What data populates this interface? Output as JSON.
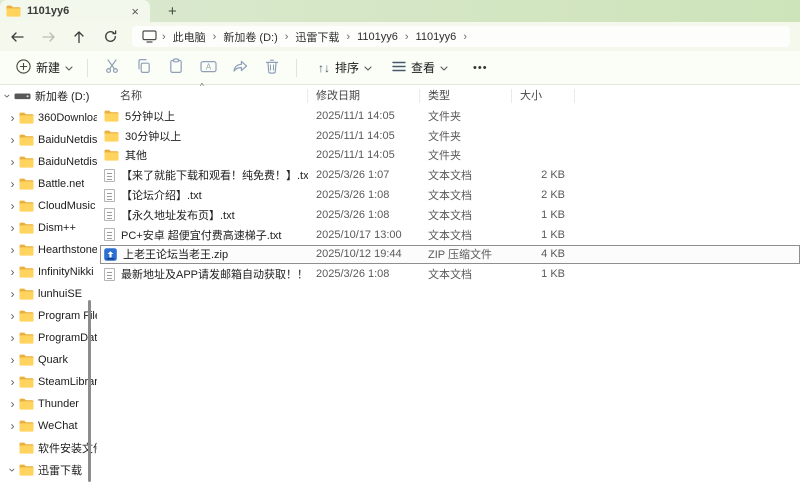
{
  "tab_bar": {
    "active_tab": {
      "label": "1101yy6",
      "icon": "folder-icon",
      "close_glyph": "×"
    },
    "new_tab_glyph": "+"
  },
  "nav": {
    "back_icon": "arrow-left",
    "forward_icon": "arrow-right",
    "up_icon": "arrow-up",
    "refresh_icon": "refresh",
    "forward_disabled": true
  },
  "breadcrumb": {
    "device_icon": "monitor-icon",
    "separator": "›",
    "items": [
      "此电脑",
      "新加卷 (D:)",
      "迅雷下载",
      "1101yy6",
      "1101yy6"
    ]
  },
  "toolbar": {
    "new_label": "新建",
    "actions": [
      "cut",
      "copy",
      "paste",
      "rename",
      "share",
      "delete"
    ],
    "sort_glyph": "↑↓",
    "sort_label": "排序",
    "view_label": "查看",
    "more_glyph": "•••"
  },
  "sidebar": {
    "items": [
      {
        "label": "新加卷 (D:)",
        "icon": "drive",
        "chevron": "expanded",
        "depth": 0
      },
      {
        "label": "360Downloa",
        "icon": "folder",
        "chevron": "collapsed",
        "depth": 1
      },
      {
        "label": "BaiduNetdis",
        "icon": "folder",
        "chevron": "collapsed",
        "depth": 1
      },
      {
        "label": "BaiduNetdis",
        "icon": "folder",
        "chevron": "collapsed",
        "depth": 1
      },
      {
        "label": "Battle.net",
        "icon": "folder",
        "chevron": "collapsed",
        "depth": 1
      },
      {
        "label": "CloudMusic",
        "icon": "folder",
        "chevron": "collapsed",
        "depth": 1
      },
      {
        "label": "Dism++",
        "icon": "folder",
        "chevron": "collapsed",
        "depth": 1
      },
      {
        "label": "Hearthstone",
        "icon": "folder",
        "chevron": "collapsed",
        "depth": 1
      },
      {
        "label": "InfinityNikki",
        "icon": "folder",
        "chevron": "collapsed",
        "depth": 1
      },
      {
        "label": "lunhuiSE",
        "icon": "folder",
        "chevron": "collapsed",
        "depth": 1
      },
      {
        "label": "Program File",
        "icon": "folder",
        "chevron": "collapsed",
        "depth": 1
      },
      {
        "label": "ProgramDat",
        "icon": "folder",
        "chevron": "collapsed",
        "depth": 1
      },
      {
        "label": "Quark",
        "icon": "folder",
        "chevron": "collapsed",
        "depth": 1
      },
      {
        "label": "SteamLibrar",
        "icon": "folder",
        "chevron": "collapsed",
        "depth": 1
      },
      {
        "label": "Thunder",
        "icon": "folder",
        "chevron": "collapsed",
        "depth": 1
      },
      {
        "label": "WeChat",
        "icon": "folder",
        "chevron": "collapsed",
        "depth": 1
      },
      {
        "label": "软件安装文件",
        "icon": "folder",
        "chevron": "none",
        "depth": 1
      },
      {
        "label": "迅雷下载",
        "icon": "folder",
        "chevron": "expanded",
        "depth": 1
      }
    ]
  },
  "file_list": {
    "columns": [
      {
        "label": "名称",
        "sort": "asc"
      },
      {
        "label": "修改日期"
      },
      {
        "label": "类型"
      },
      {
        "label": "大小"
      }
    ],
    "sort_caret_glyph": "^",
    "rows": [
      {
        "name": "5分钟以上",
        "date": "2025/11/1 14:05",
        "type": "文件夹",
        "size": "",
        "icon": "folder",
        "selected": false
      },
      {
        "name": "30分钟以上",
        "date": "2025/11/1 14:05",
        "type": "文件夹",
        "size": "",
        "icon": "folder",
        "selected": false
      },
      {
        "name": "其他",
        "date": "2025/11/1 14:05",
        "type": "文件夹",
        "size": "",
        "icon": "folder",
        "selected": false
      },
      {
        "name": "【来了就能下载和观看！纯免费！】.txt",
        "date": "2025/3/26 1:07",
        "type": "文本文档",
        "size": "2 KB",
        "icon": "txt",
        "selected": false
      },
      {
        "name": "【论坛介绍】.txt",
        "date": "2025/3/26 1:08",
        "type": "文本文档",
        "size": "2 KB",
        "icon": "txt",
        "selected": false
      },
      {
        "name": "【永久地址发布页】.txt",
        "date": "2025/3/26 1:08",
        "type": "文本文档",
        "size": "1 KB",
        "icon": "txt",
        "selected": false
      },
      {
        "name": "PC+安卓 超便宜付费高速梯子.txt",
        "date": "2025/10/17 13:00",
        "type": "文本文档",
        "size": "1 KB",
        "icon": "txt",
        "selected": false
      },
      {
        "name": "上老王论坛当老王.zip",
        "date": "2025/10/12 19:44",
        "type": "ZIP 压缩文件",
        "size": "4 KB",
        "icon": "zip",
        "selected": true
      },
      {
        "name": "最新地址及APP请发邮箱自动获取！！！.txt",
        "date": "2025/3/26 1:08",
        "type": "文本文档",
        "size": "1 KB",
        "icon": "txt",
        "selected": false
      }
    ]
  }
}
